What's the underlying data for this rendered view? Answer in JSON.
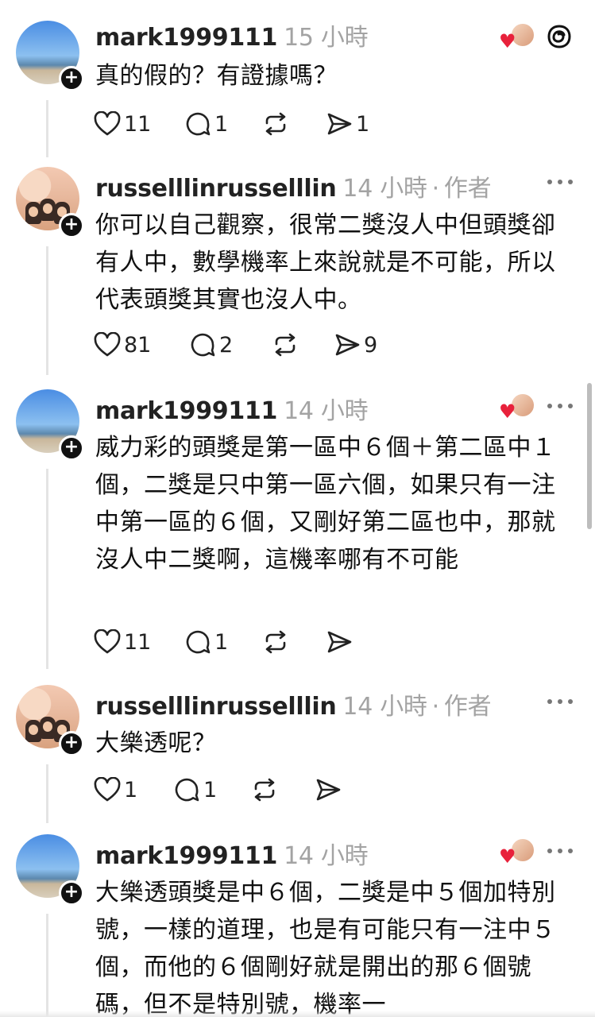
{
  "app": {
    "threads_icon": "threads-logo-icon"
  },
  "posts": [
    {
      "username": "mark1999111",
      "time": "15 小時",
      "author_tag": "",
      "content": "真的假的？有證據嗎？",
      "likes": "11",
      "replies": "1",
      "reposts": "",
      "shares": "1",
      "liked_by_author": true
    },
    {
      "username": "russelllinrusselllin",
      "time": "14 小時",
      "author_tag": "作者",
      "content": "你可以自己觀察，很常二獎沒人中但頭獎卻有人中，數學機率上來說就是不可能，所以代表頭獎其實也沒人中。",
      "likes": "81",
      "replies": "2",
      "reposts": "",
      "shares": "9",
      "liked_by_author": false
    },
    {
      "username": "mark1999111",
      "time": "14 小時",
      "author_tag": "",
      "content": "威力彩的頭獎是第一區中６個＋第二區中１個，二獎是只中第一區六個，如果只有一注中第一區的６個，又剛好第二區也中，那就沒人中二獎啊，這機率哪有不可能",
      "likes": "11",
      "replies": "1",
      "reposts": "",
      "shares": "",
      "liked_by_author": true
    },
    {
      "username": "russelllinrusselllin",
      "time": "14 小時",
      "author_tag": "作者",
      "content": "大樂透呢？",
      "likes": "1",
      "replies": "1",
      "reposts": "",
      "shares": "",
      "liked_by_author": false
    },
    {
      "username": "mark1999111",
      "time": "14 小時",
      "author_tag": "",
      "content": "大樂透頭獎是中６個，二獎是中５個加特別號，一樣的道理，也是有可能只有一注中５個，而他的６個剛好就是開出的那６個號碼，但不是特別號，機率一",
      "likes": "",
      "replies": "",
      "reposts": "",
      "shares": "",
      "liked_by_author": true
    }
  ],
  "colors": {
    "heart": "#e8213b",
    "muted": "#a3a3a3",
    "text": "#111111"
  }
}
